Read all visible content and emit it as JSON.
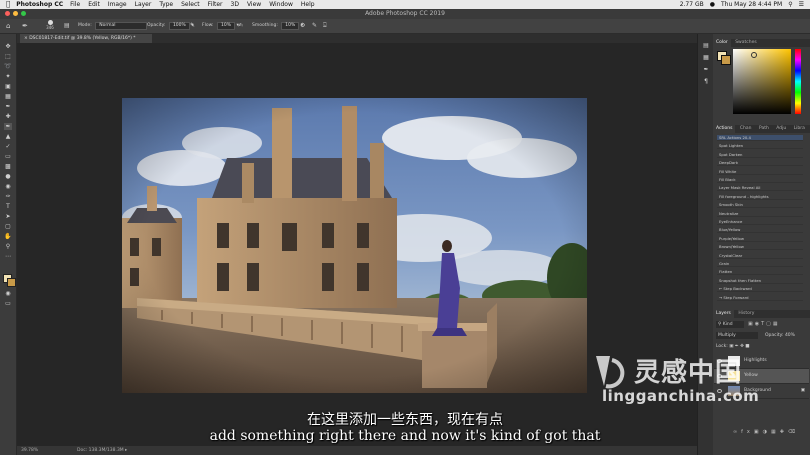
{
  "menubar": {
    "app": "Photoshop CC",
    "items": [
      "File",
      "Edit",
      "Image",
      "Layer",
      "Type",
      "Select",
      "Filter",
      "3D",
      "View",
      "Window",
      "Help"
    ],
    "status": [
      "2.77 GB",
      "Thu May 28  4:44 PM"
    ]
  },
  "window": {
    "title": "Adobe Photoshop CC 2019"
  },
  "options": {
    "brush_size": "346",
    "mode_label": "Mode:",
    "mode_value": "Normal",
    "opacity_label": "Opacity:",
    "opacity_value": "100%",
    "flow_label": "Flow:",
    "flow_value": "10%",
    "smoothing_label": "Smoothing:",
    "smoothing_value": "10%"
  },
  "document": {
    "tab_title": "DSC01817-Edit.tif @ 39.8% (Yellow, RGB/16*) *",
    "zoom": "39.78%",
    "doc_size": "Doc: 138.3M/138.3M"
  },
  "panels": {
    "color_tabs": [
      "Color",
      "Swatches"
    ],
    "actions_tabs": [
      "Actions",
      "Chan",
      "Path",
      "Adju",
      "Libra"
    ],
    "actions": [
      "SRL Actions 20.4",
      "Spot Lighten",
      "Spot Darken",
      "DeepDark",
      "Fill White",
      "Fill Black",
      "Layer Mask Reveal All",
      "Fill foreground - highlights",
      "Smooth Skin",
      "Neutralize",
      "EyeEnhance",
      "Blue/Yellow",
      "Purple/Yellow",
      "Brown/Yellow",
      "CrystalClear",
      "Grain",
      "Flatten",
      "Snapshot then Flatten",
      "Step Backward",
      "Step Forward"
    ],
    "layers_tabs": [
      "Layers",
      "History"
    ],
    "kind_label": "Kind",
    "blend_mode": "Multiply",
    "opacity_label": "Opacity:",
    "opacity_value": "40%",
    "lock_label": "Lock:",
    "layers": [
      "Highlights",
      "Yellow",
      "Background"
    ]
  },
  "subtitles": {
    "chinese": "在这里添加一些东西，现在有点",
    "english": "add something right there and now it's kind of got that"
  },
  "watermark": {
    "text": "lingganchina.com"
  },
  "colors": {
    "foreground": "#f2e3b5",
    "background": "#c89a48",
    "accent": "#ffd100"
  }
}
